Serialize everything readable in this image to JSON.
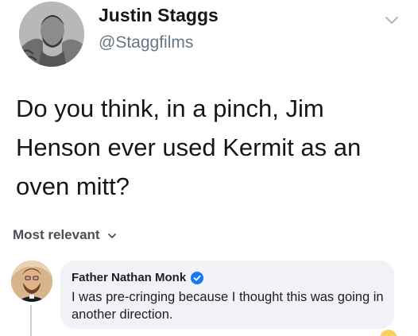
{
  "tweet": {
    "display_name": "Justin Staggs",
    "handle": "@Staggfilms",
    "text": "Do you think, in a pinch, Jim Henson ever used Kermit as an oven mitt?",
    "menu_icon": "chevron-down-icon"
  },
  "comments": {
    "sort_label": "Most relevant",
    "sort_icon": "chevron-down-icon",
    "items": [
      {
        "author": "Father Nathan Monk",
        "verified_icon": "verified-badge-icon",
        "text": "I was pre-cringing because I thought this was going in another direction."
      }
    ]
  },
  "colors": {
    "handle_gray": "#657786",
    "bubble_bg": "#f0f2f5",
    "verified_blue": "#1877f2"
  }
}
